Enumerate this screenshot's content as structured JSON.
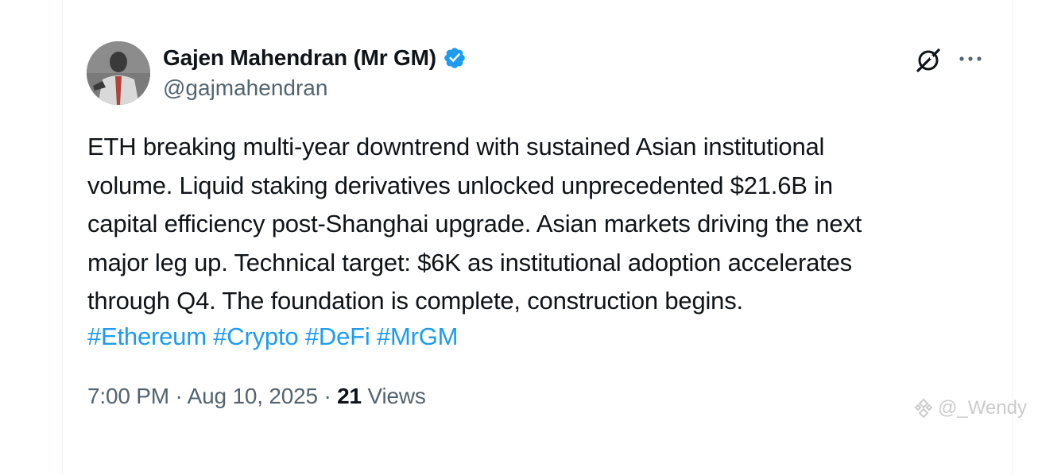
{
  "author": {
    "name": "Gajen Mahendran (Mr GM)",
    "handle": "@gajmahendran",
    "verified": true
  },
  "tweet": {
    "lines": [
      "ETH breaking multi-year downtrend with sustained Asian institutional",
      "volume. Liquid staking derivatives unlocked unprecedented $21.6B in",
      "capital efficiency post-Shanghai upgrade. Asian markets driving the next",
      "major leg up. Technical target: $6K as institutional adoption accelerates",
      "through Q4. The foundation is complete, construction begins."
    ],
    "hashtags": [
      "#Ethereum",
      "#Crypto",
      "#DeFi",
      "#MrGM"
    ]
  },
  "meta": {
    "time": "7:00 PM",
    "separator": "·",
    "date": "Aug 10, 2025",
    "views_count": "21",
    "views_label": "Views"
  },
  "icons": {
    "verified": "verified-badge-icon",
    "grok": "grok-icon",
    "more": "more-icon"
  },
  "colors": {
    "link": "#1d9bf0",
    "text": "#0f1419",
    "secondary": "#536471"
  },
  "watermark": {
    "text": "@_Wendy"
  }
}
